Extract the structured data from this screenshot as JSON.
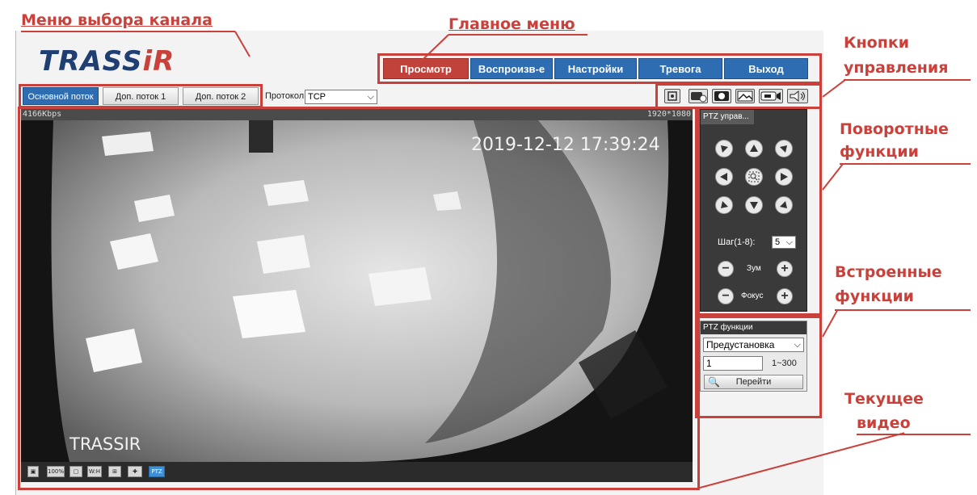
{
  "annotations": {
    "channel_menu": "Меню выбора канала",
    "main_menu": "Главное меню",
    "control_buttons_line1": "Кнопки",
    "control_buttons_line2": "управления",
    "ptz_line1": "Поворотные",
    "ptz_line2": "функции",
    "builtin_line1": "Встроенные",
    "builtin_line2": "функции",
    "video_line1": "Текущее",
    "video_line2": "видео"
  },
  "logo": {
    "text": "TRASS",
    "accent": "iR"
  },
  "main_menu": [
    {
      "label": "Просмотр",
      "active": true
    },
    {
      "label": "Воспроизв-е",
      "active": false
    },
    {
      "label": "Настройки",
      "active": false
    },
    {
      "label": "Тревога",
      "active": false
    },
    {
      "label": "Выход",
      "active": false
    }
  ],
  "stream_tabs": [
    {
      "label": "Основной поток",
      "active": true
    },
    {
      "label": "Доп. поток 1",
      "active": false
    },
    {
      "label": "Доп. поток 2",
      "active": false
    }
  ],
  "protocol": {
    "label": "Протокол",
    "value": "TCP"
  },
  "control_icons": [
    "fullscreen-icon",
    "record-add-icon",
    "record-icon",
    "snapshot-icon",
    "camera-record-icon",
    "speaker-icon"
  ],
  "video": {
    "bitrate": "4166Kbps",
    "resolution": "1920*1080",
    "timestamp": "2019-12-12 17:39:24",
    "watermark": "TRASSIR",
    "toolbar": [
      "100%",
      "W:H",
      "PTZ"
    ]
  },
  "ptz": {
    "tab": "PTZ управ...",
    "step_label": "Шаг(1-8):",
    "step_value": "5",
    "zoom_label": "Зум",
    "focus_label": "Фокус"
  },
  "ptz_functions": {
    "header": "PTZ функции",
    "mode": "Предустановка",
    "preset_value": "1",
    "range": "1~300",
    "go_label": "Перейти"
  },
  "colors": {
    "accent_red": "#c9413a",
    "menu_blue": "#2f6db2",
    "menu_active": "#c0423a"
  }
}
